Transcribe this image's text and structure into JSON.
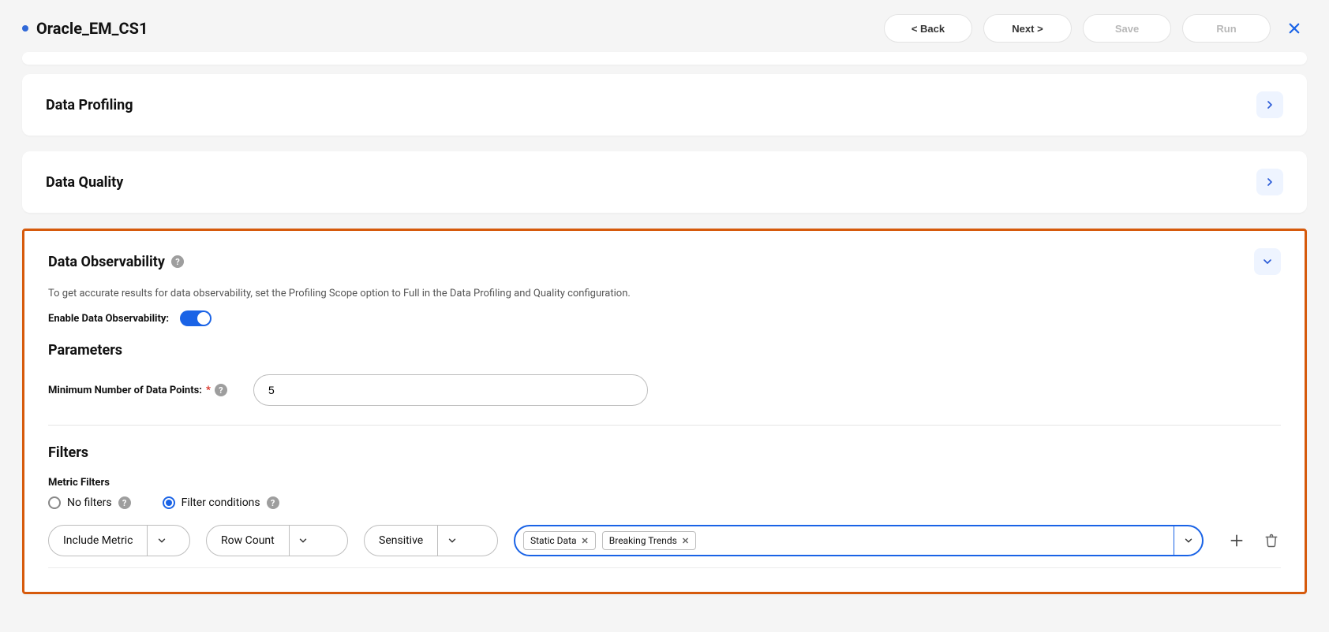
{
  "header": {
    "title": "Oracle_EM_CS1",
    "buttons": {
      "back": "< Back",
      "next": "Next >",
      "save": "Save",
      "run": "Run"
    }
  },
  "cards": {
    "profiling": {
      "title": "Data Profiling"
    },
    "quality": {
      "title": "Data Quality"
    }
  },
  "observability": {
    "title": "Data Observability",
    "info": "To get accurate results for data observability, set the Profiling Scope option to Full in the Data Profiling and Quality configuration.",
    "toggle_label": "Enable Data Observability:",
    "toggle_on": true,
    "parameters": {
      "title": "Parameters",
      "min_points_label": "Minimum Number of Data Points:",
      "min_points_value": "5"
    },
    "filters": {
      "title": "Filters",
      "metric_label": "Metric Filters",
      "radio_no_filters": "No filters",
      "radio_conditions": "Filter conditions",
      "row": {
        "action": "Include Metric",
        "metric": "Row Count",
        "mode": "Sensitive",
        "tags": [
          "Static Data",
          "Breaking Trends"
        ]
      }
    }
  }
}
